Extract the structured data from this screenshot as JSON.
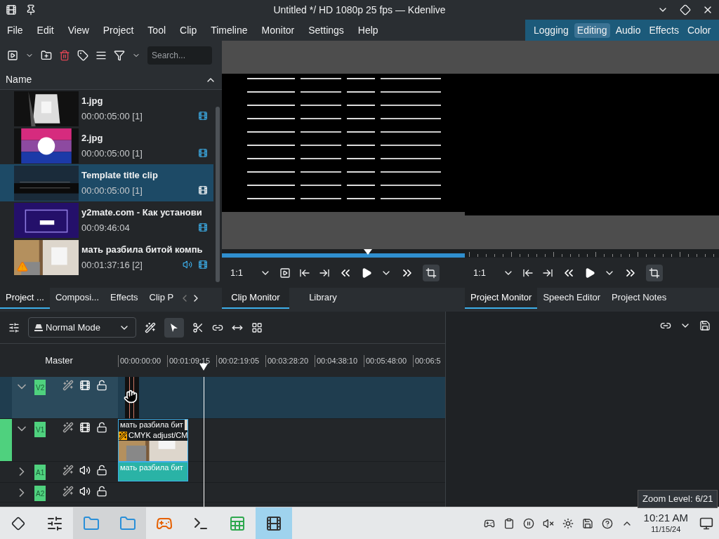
{
  "window": {
    "title": "Untitled */ HD 1080p 25 fps — Kdenlive"
  },
  "menu": [
    "File",
    "Edit",
    "View",
    "Project",
    "Tool",
    "Clip",
    "Timeline",
    "Monitor",
    "Settings",
    "Help"
  ],
  "workspaces": [
    {
      "label": "Logging",
      "selected": false
    },
    {
      "label": "Editing",
      "selected": true
    },
    {
      "label": "Audio",
      "selected": false
    },
    {
      "label": "Effects",
      "selected": false
    },
    {
      "label": "Color",
      "selected": false
    }
  ],
  "bin": {
    "search": {
      "placeholder": "Search..."
    },
    "header": "Name",
    "clips": [
      {
        "name": "1.jpg",
        "duration": "00:00:05:00 [1]",
        "selected": false,
        "audio": false,
        "warning": false
      },
      {
        "name": "2.jpg",
        "duration": "00:00:05:00 [1]",
        "selected": false,
        "audio": false,
        "warning": false
      },
      {
        "name": "Template title clip",
        "duration": "00:00:05:00 [1]",
        "selected": true,
        "audio": false,
        "warning": false
      },
      {
        "name": "y2mate.com - Как установи",
        "duration": "00:09:46:04",
        "selected": false,
        "audio": false,
        "warning": false
      },
      {
        "name": "мать разбила битой компь",
        "duration": "00:01:37:16 [2]",
        "selected": false,
        "audio": true,
        "warning": true
      }
    ],
    "tabs": [
      {
        "label": "Project ...",
        "selected": true
      },
      {
        "label": "Composi...",
        "selected": false
      },
      {
        "label": "Effects",
        "selected": false
      },
      {
        "label": "Clip P",
        "selected": false
      }
    ]
  },
  "clip_monitor": {
    "zoom": "1:1",
    "level": 0.6,
    "tabs": [
      {
        "label": "Clip Monitor",
        "selected": true
      },
      {
        "label": "Library",
        "selected": false
      }
    ]
  },
  "project_monitor": {
    "zoom": "1:1",
    "tabs": [
      {
        "label": "Project Monitor",
        "selected": true
      },
      {
        "label": "Speech Editor",
        "selected": false
      },
      {
        "label": "Project Notes",
        "selected": false
      }
    ]
  },
  "timeline": {
    "mode": "Normal Mode",
    "master": "Master",
    "ruler": [
      "00:00:00:00",
      "00:01:09:15",
      "00:02:19:05",
      "00:03:28:20",
      "00:04:38:10",
      "00:05:48:00",
      "00:06:5"
    ],
    "tracks": [
      {
        "label": "V2",
        "kind": "video",
        "expanded": true,
        "selected": true,
        "active": false
      },
      {
        "label": "V1",
        "kind": "video",
        "expanded": true,
        "selected": false,
        "active": true
      },
      {
        "label": "A1",
        "kind": "audio",
        "expanded": false,
        "selected": false,
        "active": false
      },
      {
        "label": "A2",
        "kind": "audio",
        "expanded": false,
        "selected": false,
        "active": false
      }
    ],
    "video_clip": {
      "title": "мать разбила бит",
      "effect": "CMYK adjust/CM"
    },
    "audio_clip": {
      "title": "мать разбила бит"
    }
  },
  "tooltip": "Zoom Level: 6/21",
  "taskbar": {
    "time": "10:21 AM",
    "date": "11/15/24"
  }
}
